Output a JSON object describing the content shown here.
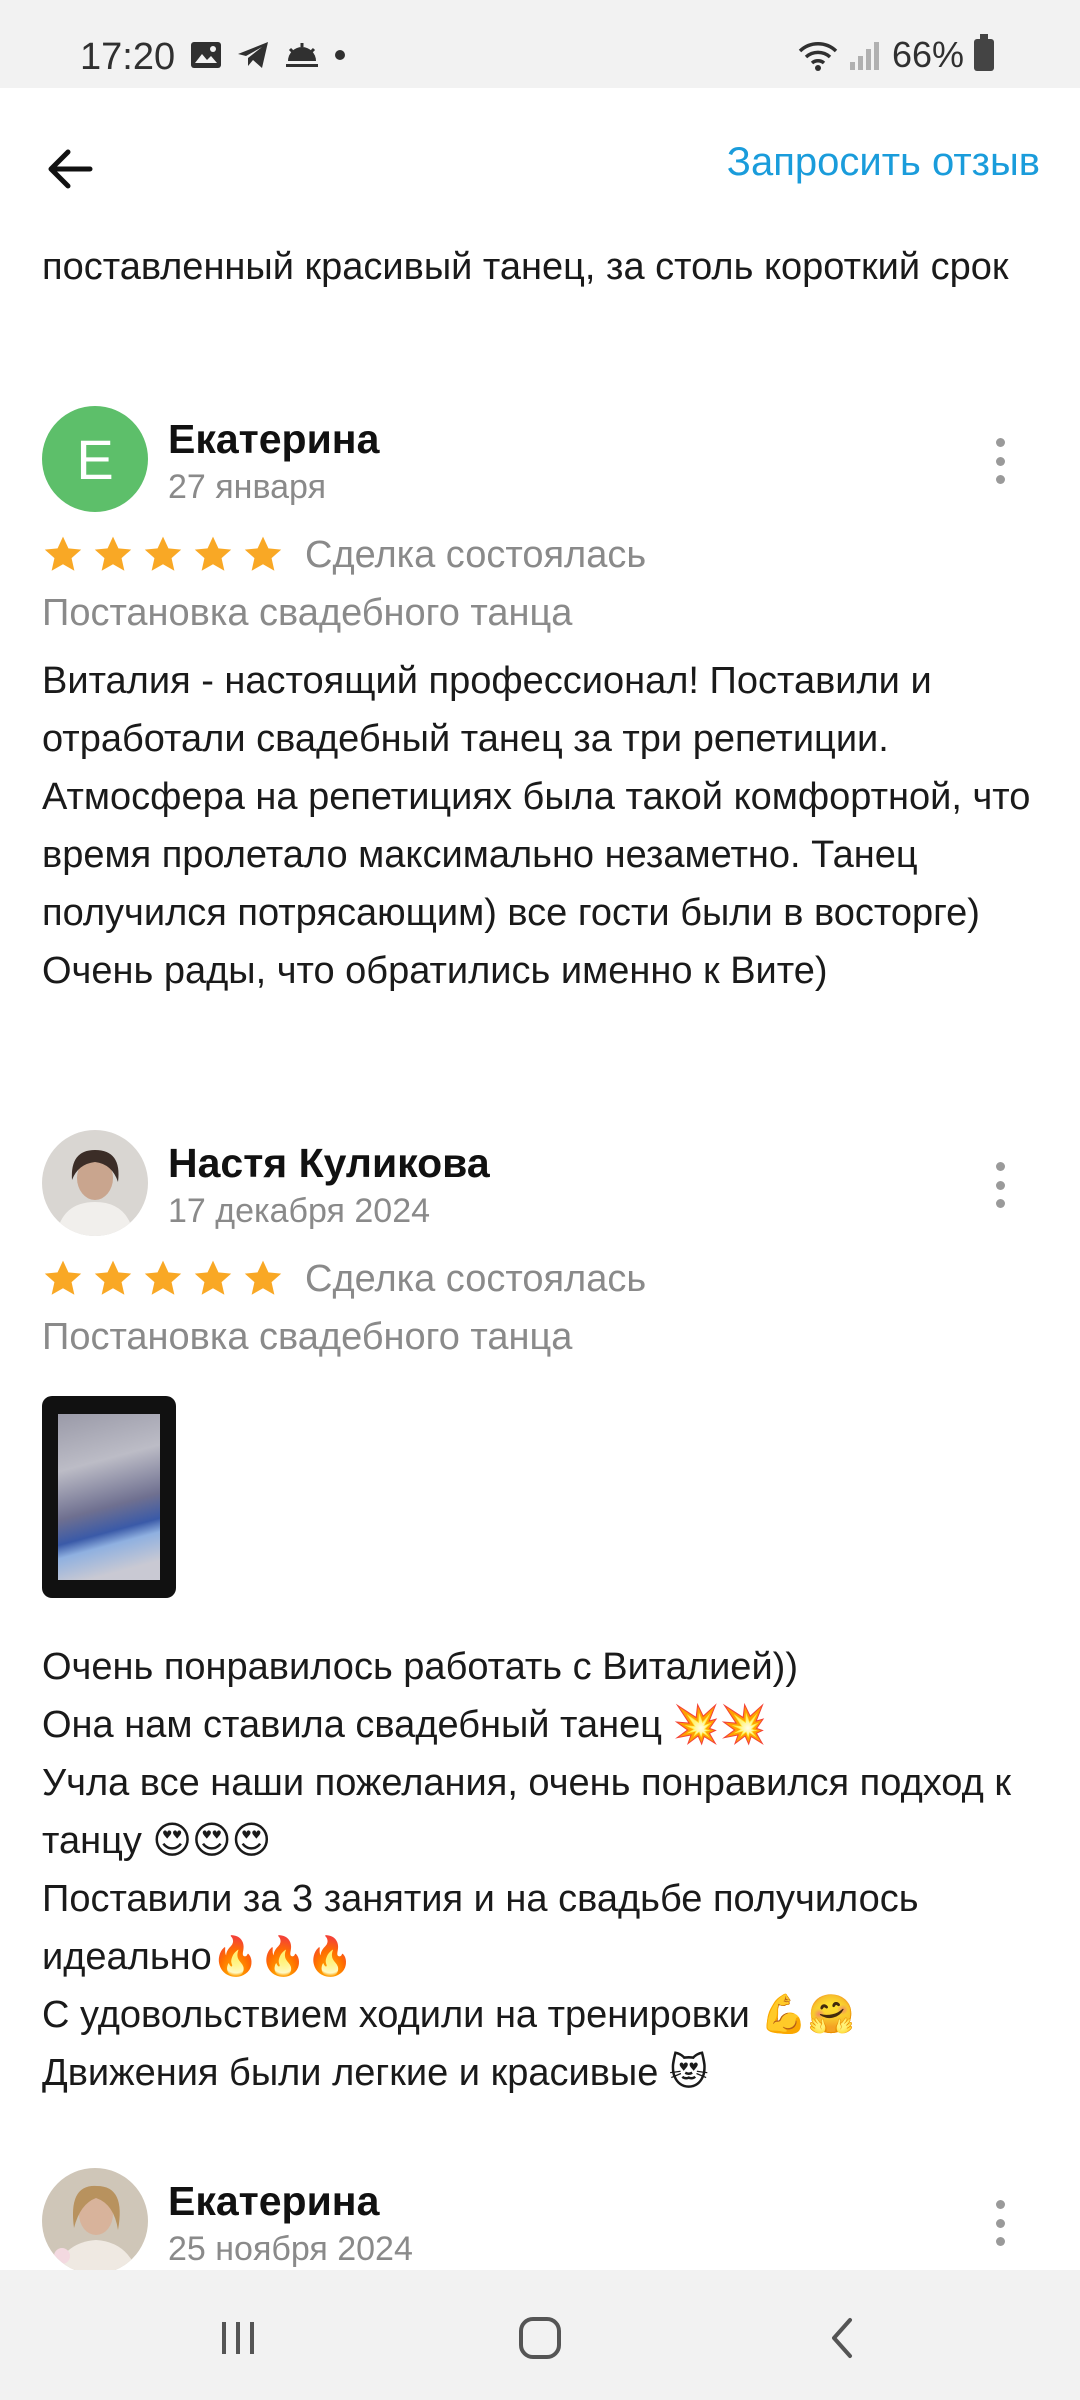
{
  "status": {
    "time": "17:20",
    "battery": "66%"
  },
  "header": {
    "request_label": "Запросить отзыв"
  },
  "previous_review_tail": "поставленный красивый танец, за столь короткий срок",
  "reviews": [
    {
      "author": "Екатерина",
      "avatar_letter": "Е",
      "date": "27 января",
      "rating": 5,
      "deal_status": "Сделка состоялась",
      "service": "Постановка свадебного танца",
      "text": "Виталия - настоящий профессионал! Поставили и отработали свадебный танец за три репетиции. Атмосфера на репетициях была такой комфортной, что время пролетало максимально незаметно. Танец получился потрясающим) все гости были в восторге)\nОчень рады, что обратились именно к Вите)"
    },
    {
      "author": "Настя Куликова",
      "date": "17 декабря 2024",
      "rating": 5,
      "deal_status": "Сделка состоялась",
      "service": "Постановка свадебного танца",
      "text": "Очень понравилось работать с Виталией))\nОна нам ставила свадебный танец 💥💥\nУчла все наши пожелания, очень понравился подход к танцу 😍😍😍\nПоставили за 3 занятия и на свадьбе получилось идеально🔥🔥🔥\nС удовольствием ходили на тренировки 💪🤗\nДвижения были легкие и красивые 😻"
    },
    {
      "author": "Екатерина",
      "date": "25 ноября 2024"
    }
  ],
  "colors": {
    "accent": "#1a9cdb",
    "star": "#f9a825",
    "avatar_green": "#5dbf6a",
    "muted": "#8a8a8a"
  }
}
